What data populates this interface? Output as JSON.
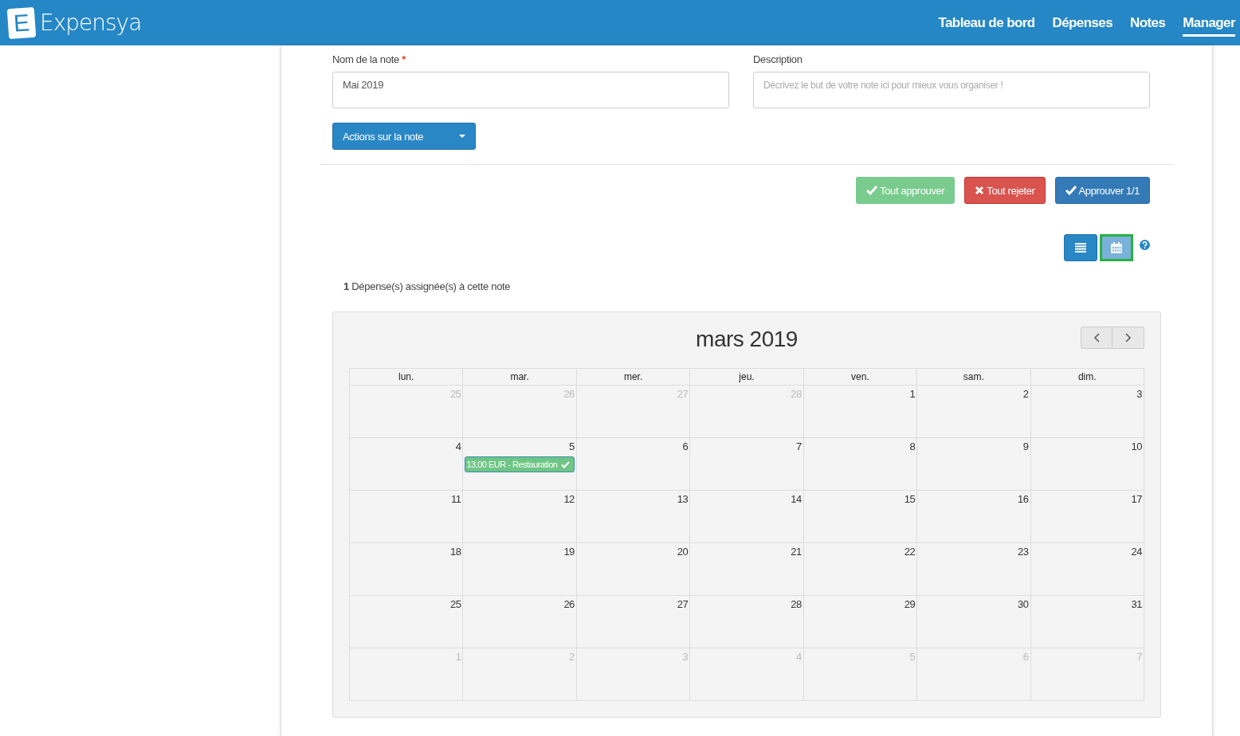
{
  "brand": {
    "name": "Expensya",
    "logo_letter": "E"
  },
  "nav": [
    {
      "label": "Tableau de bord",
      "selected": false
    },
    {
      "label": "Dépenses",
      "selected": false
    },
    {
      "label": "Notes",
      "selected": false
    },
    {
      "label": "Manager",
      "selected": true
    }
  ],
  "form": {
    "name_label": "Nom de la note",
    "required_mark": "*",
    "name_value": "Mai 2019",
    "description_label": "Description",
    "description_placeholder": "Décrivez le but de votre note ici pour mieux vous organiser !",
    "actions_button": "Actions sur la note"
  },
  "approval_buttons": [
    {
      "label": "Tout approuver",
      "kind": "approve"
    },
    {
      "label": "Tout rejeter",
      "kind": "reject"
    },
    {
      "label": "Approuver 1/1",
      "kind": "primary"
    }
  ],
  "view_toggle": [
    {
      "kind": "list",
      "selected": false
    },
    {
      "kind": "calendar",
      "selected": true
    }
  ],
  "summary": "**1** Dépense(s) assignée(s) à cette note",
  "calendar": {
    "title": "mars 2019",
    "weekdays": [
      "lun.",
      "mar.",
      "mer.",
      "jeu.",
      "ven.",
      "sam.",
      "dim."
    ],
    "weeks": [
      [
        {
          "day": "25",
          "other_month": true
        },
        {
          "day": "26",
          "other_month": true
        },
        {
          "day": "27",
          "other_month": true
        },
        {
          "day": "28",
          "other_month": true
        },
        {
          "day": "1",
          "other_month": false
        },
        {
          "day": "2",
          "other_month": false
        },
        {
          "day": "3",
          "other_month": false
        }
      ],
      [
        {
          "day": "4",
          "other_month": false
        },
        {
          "day": "5",
          "other_month": false,
          "events": [
            {
              "label": "13,00 EUR - Restauration",
              "approved": true
            }
          ]
        },
        {
          "day": "6",
          "other_month": false
        },
        {
          "day": "7",
          "other_month": false
        },
        {
          "day": "8",
          "other_month": false
        },
        {
          "day": "9",
          "other_month": false
        },
        {
          "day": "10",
          "other_month": false
        }
      ],
      [
        {
          "day": "11",
          "other_month": false
        },
        {
          "day": "12",
          "other_month": false
        },
        {
          "day": "13",
          "other_month": false
        },
        {
          "day": "14",
          "other_month": false
        },
        {
          "day": "15",
          "other_month": false
        },
        {
          "day": "16",
          "other_month": false
        },
        {
          "day": "17",
          "other_month": false
        }
      ],
      [
        {
          "day": "18",
          "other_month": false
        },
        {
          "day": "19",
          "other_month": false
        },
        {
          "day": "20",
          "other_month": false
        },
        {
          "day": "21",
          "other_month": false
        },
        {
          "day": "22",
          "other_month": false
        },
        {
          "day": "23",
          "other_month": false
        },
        {
          "day": "24",
          "other_month": false
        }
      ],
      [
        {
          "day": "25",
          "other_month": false
        },
        {
          "day": "26",
          "other_month": false
        },
        {
          "day": "27",
          "other_month": false
        },
        {
          "day": "28",
          "other_month": false
        },
        {
          "day": "29",
          "other_month": false
        },
        {
          "day": "30",
          "other_month": false
        },
        {
          "day": "31",
          "other_month": false
        }
      ],
      [
        {
          "day": "1",
          "other_month": true
        },
        {
          "day": "2",
          "other_month": true
        },
        {
          "day": "3",
          "other_month": true
        },
        {
          "day": "4",
          "other_month": true
        },
        {
          "day": "5",
          "other_month": true
        },
        {
          "day": "6",
          "other_month": true
        },
        {
          "day": "7",
          "other_month": true
        }
      ]
    ]
  }
}
